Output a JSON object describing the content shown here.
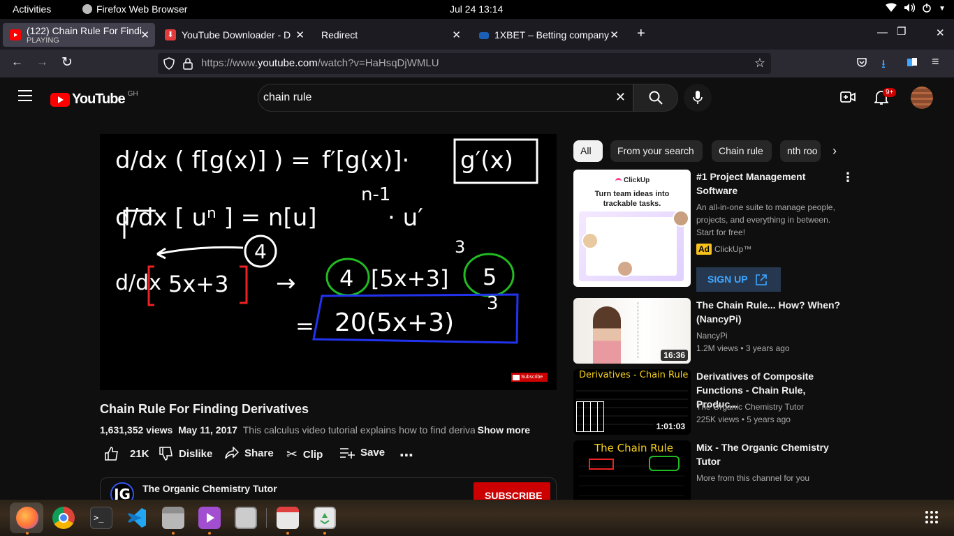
{
  "topbar": {
    "activities": "Activities",
    "app_name": "Firefox Web Browser",
    "clock": "Jul 24  13:14"
  },
  "tabs": [
    {
      "title": "(122) Chain Rule For Findi",
      "subtitle": "PLAYING",
      "favicon_color": "#ff0000"
    },
    {
      "title": "YouTube Downloader - D",
      "favicon_color": "#e33b3b"
    },
    {
      "title": "Redirect",
      "favicon_color": ""
    },
    {
      "title": "1XBET – Betting company",
      "favicon_color": "#1a5fb4"
    }
  ],
  "nav": {
    "url_prefix": "https://www.",
    "url_domain": "youtube.com",
    "url_path": "/watch?v=HaHsqDjWMLU"
  },
  "youtube": {
    "logo_text": "YouTube",
    "country": "GH",
    "search_value": "chain rule",
    "notif_badge": "9+"
  },
  "video": {
    "title": "Chain Rule For Finding Derivatives",
    "views": "1,631,352 views",
    "date": "May 11, 2017",
    "description": "This calculus video tutorial explains how to find deriva",
    "show_more": "Show more",
    "likes": "21K",
    "dislike": "Dislike",
    "share": "Share",
    "clip": "Clip",
    "save": "Save",
    "subscribe_watermark": "Subscribe",
    "channel_name": "The Organic Chemistry Tutor",
    "channel_avatar": "JG",
    "subscribe": "SUBSCRIBE"
  },
  "board": {
    "line1_left": "d/dx ( f[g(x)] ) =",
    "line1_right": "f′[g(x)]·",
    "line1_box": "g′(x)",
    "line2": "d/dx [ uⁿ ] = n[u]",
    "line2_exp": "n-1",
    "line2_tail": "· u′",
    "circle4": "4",
    "line3_left": "d/dx",
    "line3_bracket": "5x+3",
    "line3_arrow": "→",
    "line3_c1": "4",
    "line3_mid": "[5x+3]",
    "line3_exp": "3",
    "line3_c2": "5",
    "line4_eq": "=",
    "line4_box": "20(5x+3)",
    "line4_exp": "3"
  },
  "chips": [
    "All",
    "From your search",
    "Chain rule",
    "nth roo"
  ],
  "ad": {
    "brand_logo": "ClickUp",
    "headline": "Turn team ideas into trackable tasks.",
    "title": "#1 Project Management Software",
    "desc": "An all-in-one suite to manage people, projects, and everything in between. Start for free!",
    "badge": "Ad",
    "advertiser": "ClickUp™",
    "cta": "SIGN UP"
  },
  "related": [
    {
      "title": "The Chain Rule... How? When? (NancyPi)",
      "channel": "NancyPi",
      "meta": "1.2M views • 3 years ago",
      "duration": "16:36"
    },
    {
      "title": "Derivatives of Composite Functions - Chain Rule, Produc...",
      "channel": "The Organic Chemistry Tutor",
      "meta": "225K views • 5 years ago",
      "duration": "1:01:03",
      "thumb_title": "Derivatives - Chain Rule"
    },
    {
      "title": "Mix - The Organic Chemistry Tutor",
      "channel": "More from this channel for you",
      "meta": "",
      "thumb_title": "The Chain Rule"
    }
  ],
  "colors": {
    "youtube_red": "#ff0000",
    "link_blue": "#3ea6ff",
    "firefox_orange": "#ff9500"
  }
}
